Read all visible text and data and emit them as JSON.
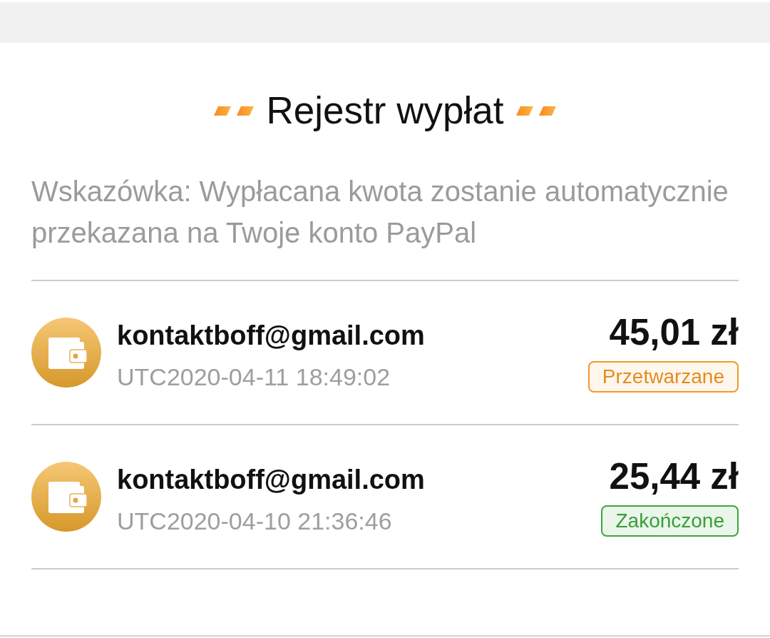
{
  "page": {
    "title": "Rejestr wypłat",
    "hint": "Wskazówka: Wypłacana kwota zostanie automatycznie przekazana na Twoje konto PayPal"
  },
  "payouts": [
    {
      "account": "kontaktboff@gmail.com",
      "time": "UTC2020-04-11 18:49:02",
      "amount": "45,01 zł",
      "status": {
        "label": "Przetwarzane",
        "kind": "processing"
      }
    },
    {
      "account": "kontaktboff@gmail.com",
      "time": "UTC2020-04-10 21:36:46",
      "amount": "25,44 zł",
      "status": {
        "label": "Zakończone",
        "kind": "completed"
      }
    }
  ]
}
